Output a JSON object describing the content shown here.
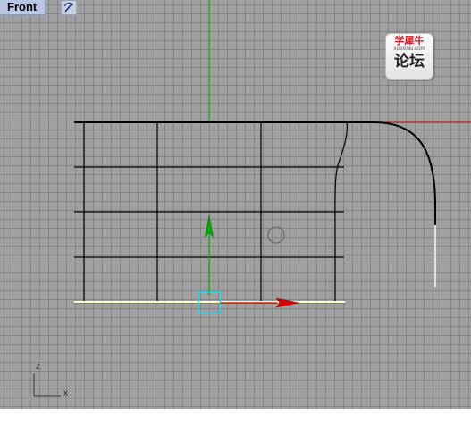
{
  "viewport": {
    "title": "Front",
    "view_icon": "perspective-switch-icon"
  },
  "watermark": {
    "brand": "学犀牛",
    "site": "xuexiniu.com",
    "forum": "论坛"
  },
  "axes_icon": {
    "z_label": "z",
    "x_label": "x"
  },
  "colors": {
    "grid_background": "#a0a0a0",
    "grid_line": "#707070",
    "y_axis": "#00b400",
    "x_axis": "#b40000",
    "curve": "#000000",
    "selection_edge": "#ffffcc",
    "gizmo_box": "#00e5ff",
    "gizmo_y_arrow": "#00b000",
    "gizmo_x_arrow": "#dd0000"
  }
}
